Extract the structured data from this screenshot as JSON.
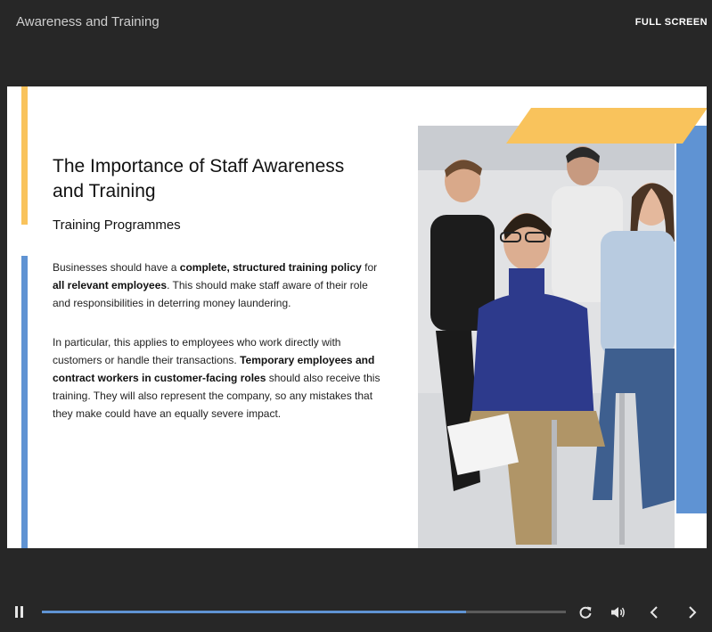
{
  "header": {
    "title": "Awareness and Training",
    "fullscreen_label": "FULL SCREEN"
  },
  "slide": {
    "heading": "The Importance of Staff Awareness and Training",
    "subheading": "Training Programmes",
    "p1": {
      "t1": "Businesses should have a ",
      "b1": "complete, structured training policy",
      "t2": " for ",
      "b2": "all relevant employees",
      "t3": ". This should make staff aware of their role and responsibilities in deterring money laundering."
    },
    "p2": {
      "t1": "In particular, this applies to employees who work directly with customers or handle their transactions. ",
      "b1": "Temporary employees and contract workers in customer-facing roles",
      "t2": " should also receive this training. They will also represent the company, so any mistakes that they make could have an equally severe impact."
    },
    "colors": {
      "yellow": "#f9c35c",
      "blue": "#5f93d3"
    }
  },
  "player": {
    "progress_percent": 81,
    "icons": [
      "pause-icon",
      "replay-icon",
      "volume-icon",
      "chevron-left-icon",
      "chevron-right-icon"
    ]
  }
}
